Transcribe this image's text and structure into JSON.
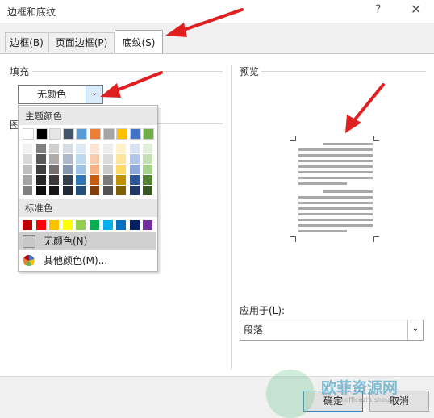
{
  "window": {
    "title": "边框和底纹",
    "help_glyph": "?",
    "close_glyph": "✕"
  },
  "tabs": [
    {
      "label": "边框(B)"
    },
    {
      "label": "页面边框(P)"
    },
    {
      "label": "底纹(S)"
    }
  ],
  "fill": {
    "section_label": "填充",
    "selected_value": "无颜色",
    "pattern_label_partial": "图"
  },
  "color_menu": {
    "theme_header": "主题颜色",
    "standard_header": "标准色",
    "theme_base": [
      "#ffffff",
      "#000000",
      "#e7e6e6",
      "#44546a",
      "#5b9bd5",
      "#ed7d31",
      "#a5a5a5",
      "#ffc000",
      "#4472c4",
      "#70ad47"
    ],
    "theme_shades": [
      [
        "#f2f2f2",
        "#7f7f7f",
        "#d0cece",
        "#d6dce4",
        "#deebf6",
        "#fbe5d5",
        "#ededed",
        "#fff2cc",
        "#d9e2f3",
        "#e2efd9"
      ],
      [
        "#d8d8d8",
        "#595959",
        "#aeabab",
        "#adb9ca",
        "#bdd7ee",
        "#f7cbac",
        "#dbdbdb",
        "#fee599",
        "#b4c6e7",
        "#c5e0b3"
      ],
      [
        "#bfbfbf",
        "#3f3f3f",
        "#757070",
        "#8496b0",
        "#9cc3e5",
        "#f4b183",
        "#c9c9c9",
        "#ffd965",
        "#8eaadb",
        "#a8d08d"
      ],
      [
        "#a5a5a5",
        "#262626",
        "#3a3838",
        "#323f4f",
        "#2e75b5",
        "#c55a11",
        "#7b7b7b",
        "#bf9000",
        "#2f5496",
        "#538135"
      ],
      [
        "#7f7f7f",
        "#0c0c0c",
        "#171616",
        "#222a35",
        "#1e4e79",
        "#833c0b",
        "#525252",
        "#7f6000",
        "#1f3864",
        "#375623"
      ]
    ],
    "standard": [
      "#c00000",
      "#ff0000",
      "#ffc000",
      "#ffff00",
      "#92d050",
      "#00b050",
      "#00b0f0",
      "#0070c0",
      "#002060",
      "#7030a0"
    ],
    "no_color_item": "无颜色(N)",
    "more_colors_item": "其他颜色(M)..."
  },
  "preview": {
    "section_label": "预览"
  },
  "apply_to": {
    "label": "应用于(L):",
    "value": "段落"
  },
  "buttons": {
    "ok": "确定",
    "cancel": "取消"
  },
  "watermark": {
    "text": "欧菲资源网",
    "subtext": "www.officezhushou.com"
  },
  "colors": {
    "arrow": "#e02020",
    "accent": "#3c7fb1"
  },
  "icons": {
    "dropdown": "chevron-down-icon",
    "palette": "palette-icon"
  }
}
